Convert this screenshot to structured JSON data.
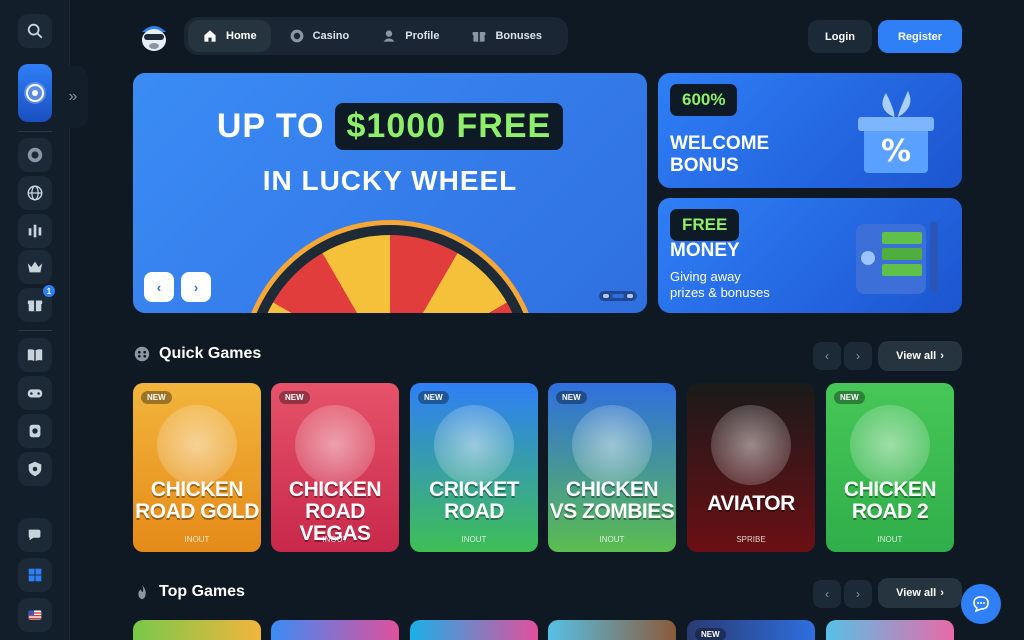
{
  "nav": {
    "items": [
      {
        "label": "Home",
        "icon": "home-icon"
      },
      {
        "label": "Casino",
        "icon": "casino-chip-icon"
      },
      {
        "label": "Profile",
        "icon": "user-icon"
      },
      {
        "label": "Bonuses",
        "icon": "gift-icon"
      }
    ],
    "active": "Home"
  },
  "auth": {
    "login": "Login",
    "register": "Register"
  },
  "sidebar": {
    "items": [
      "search-icon",
      "lucky-wheel",
      "casino-chip-icon",
      "globe-icon",
      "chart-icon",
      "crown-icon",
      "gift-icon",
      "book-icon",
      "gamepad-icon",
      "coin-stack-icon",
      "shield-icon",
      "chat-icon",
      "windows-icon",
      "us-flag-icon"
    ],
    "gift_badge": "1"
  },
  "hero": {
    "line1_prefix": "UP TO",
    "line1_highlight": "$1000 FREE",
    "line2": "IN LUCKY WHEEL",
    "prev": "‹",
    "next": "›"
  },
  "promos": [
    {
      "pill": "600%",
      "title_line1": "WELCOME",
      "title_line2": "BONUS"
    },
    {
      "pill": "FREE",
      "title_line1": "MONEY",
      "sub_line1": "Giving away",
      "sub_line2": "prizes & bonuses"
    }
  ],
  "sections": {
    "quick": {
      "title": "Quick Games",
      "view_all": "View all"
    },
    "top": {
      "title": "Top Games",
      "view_all": "View all"
    }
  },
  "games": [
    {
      "new": "NEW",
      "title_line1": "CHICKEN",
      "title_line2": "ROAD GOLD",
      "provider": "INOUT",
      "color_top": "#f2b53c",
      "color_bottom": "#e58a18"
    },
    {
      "new": "NEW",
      "title_line1": "CHICKEN",
      "title_line2": "ROAD VEGAS",
      "provider": "INOUT",
      "color_top": "#e6536a",
      "color_bottom": "#c8284a"
    },
    {
      "new": "NEW",
      "title_line1": "CRICKET",
      "title_line2": "ROAD",
      "provider": "INOUT",
      "color_top": "#2f7ff6",
      "color_bottom": "#3fbf55"
    },
    {
      "new": "NEW",
      "title_line1": "CHICKEN",
      "title_line2": "VS ZOMBIES",
      "provider": "INOUT",
      "color_top": "#2f6fe0",
      "color_bottom": "#5bbd4f"
    },
    {
      "new": "",
      "title_line1": "AVIATOR",
      "title_line2": "",
      "provider": "SPRIBE",
      "color_top": "#1a1a1a",
      "color_bottom": "#6b0f14"
    },
    {
      "new": "NEW",
      "title_line1": "CHICKEN",
      "title_line2": "ROAD 2",
      "provider": "INOUT",
      "color_top": "#47c757",
      "color_bottom": "#2fae4a"
    }
  ],
  "top_games_new": "NEW"
}
